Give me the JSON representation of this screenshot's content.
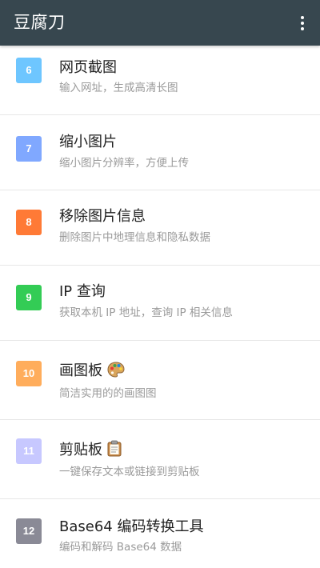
{
  "app": {
    "title": "豆腐刀",
    "colors": {
      "appbar": "#37474f",
      "divider": "#e7e7e7",
      "title_text": "#222222",
      "subtitle_text": "#9a9a9a"
    },
    "menu_icon": "more-vert-icon"
  },
  "tools": [
    {
      "num": "6",
      "title": "网页截图",
      "subtitle": "输入网址，生成高清长图",
      "color": "#6ec6ff"
    },
    {
      "num": "7",
      "title": "缩小图片",
      "subtitle": "缩小图片分辨率，方便上传",
      "color": "#80a8ff"
    },
    {
      "num": "8",
      "title": "移除图片信息",
      "subtitle": "删除图片中地理信息和隐私数据",
      "color": "#ff7a36"
    },
    {
      "num": "9",
      "title": "IP 查询",
      "subtitle": "获取本机 IP 地址，查询 IP 相关信息",
      "color": "#33cc55"
    },
    {
      "num": "10",
      "title": "画图板",
      "subtitle": "简洁实用的的画图图",
      "color": "#ffad5c",
      "icon": "palette-icon"
    },
    {
      "num": "11",
      "title": "剪贴板",
      "subtitle": "一键保存文本或链接到剪贴板",
      "color": "#c7c8ff",
      "icon": "clipboard-icon"
    },
    {
      "num": "12",
      "title": "Base64 编码转换工具",
      "subtitle": "编码和解码 Base64 数据",
      "color": "#8a8a96"
    }
  ]
}
